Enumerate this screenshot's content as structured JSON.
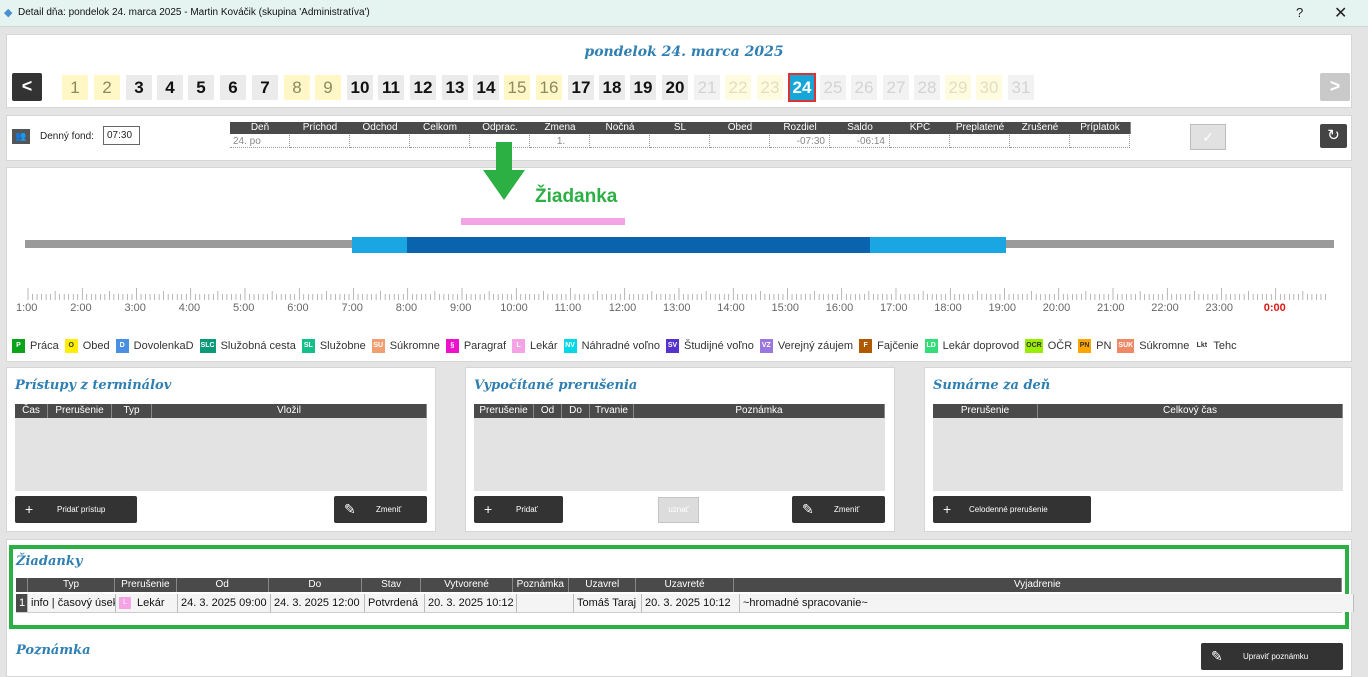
{
  "window": {
    "title": "Detail dňa: pondelok 24. marca 2025 -  Martin Kováčik  (skupina 'Administratíva')",
    "help": "?",
    "close": "✕"
  },
  "date_nav": {
    "title": "pondelok 24. marca 2025",
    "prev": "<",
    "next": ">",
    "days": [
      {
        "n": "1",
        "t": "we"
      },
      {
        "n": "2",
        "t": "we"
      },
      {
        "n": "3",
        "t": "wd"
      },
      {
        "n": "4",
        "t": "wd"
      },
      {
        "n": "5",
        "t": "wd"
      },
      {
        "n": "6",
        "t": "wd"
      },
      {
        "n": "7",
        "t": "wd"
      },
      {
        "n": "8",
        "t": "we"
      },
      {
        "n": "9",
        "t": "we"
      },
      {
        "n": "10",
        "t": "wd"
      },
      {
        "n": "11",
        "t": "wd"
      },
      {
        "n": "12",
        "t": "wd"
      },
      {
        "n": "13",
        "t": "wd"
      },
      {
        "n": "14",
        "t": "wd"
      },
      {
        "n": "15",
        "t": "we"
      },
      {
        "n": "16",
        "t": "we"
      },
      {
        "n": "17",
        "t": "wd"
      },
      {
        "n": "18",
        "t": "wd"
      },
      {
        "n": "19",
        "t": "wd"
      },
      {
        "n": "20",
        "t": "wd"
      },
      {
        "n": "21",
        "t": "fu"
      },
      {
        "n": "22",
        "t": "fuwe"
      },
      {
        "n": "23",
        "t": "fuwe"
      },
      {
        "n": "24",
        "t": "sel"
      },
      {
        "n": "25",
        "t": "fu"
      },
      {
        "n": "26",
        "t": "fu"
      },
      {
        "n": "27",
        "t": "fu"
      },
      {
        "n": "28",
        "t": "fu"
      },
      {
        "n": "29",
        "t": "fuwe"
      },
      {
        "n": "30",
        "t": "fuwe"
      },
      {
        "n": "31",
        "t": "fu"
      }
    ]
  },
  "summary": {
    "fond_label": "Denný fond:",
    "fond_value": "07:30",
    "headers": [
      "Deň",
      "Príchod",
      "Odchod",
      "Celkom",
      "Odprac.",
      "Zmena",
      "Nočná",
      "SL",
      "Obed",
      "Rozdiel",
      "Saldo",
      "KPČ",
      "Preplatené",
      "Zrušené",
      "Príplatok"
    ],
    "values": [
      "24. po",
      "",
      "",
      "",
      "",
      "1.",
      "",
      "",
      "",
      "-07:30",
      "-06:14",
      "",
      "",
      "",
      ""
    ]
  },
  "timeline": {
    "ziadanka_label": "Žiadanka",
    "hours": [
      "1:00",
      "2:00",
      "3:00",
      "4:00",
      "5:00",
      "6:00",
      "7:00",
      "8:00",
      "9:00",
      "10:00",
      "11:00",
      "12:00",
      "13:00",
      "14:00",
      "15:00",
      "16:00",
      "17:00",
      "18:00",
      "19:00",
      "20:00",
      "21:00",
      "22:00",
      "23:00",
      "0:00"
    ]
  },
  "legend": [
    {
      "code": "P",
      "label": "Práca",
      "bg": "#0aa31a",
      "fg": "#ffffff"
    },
    {
      "code": "O",
      "label": "Obed",
      "bg": "#ffee00",
      "fg": "#333333"
    },
    {
      "code": "D",
      "label": "DovolenkaD",
      "bg": "#4a90e2",
      "fg": "#ffffff"
    },
    {
      "code": "SLC",
      "label": "Služobná cesta",
      "bg": "#0a9a7a",
      "fg": "#ffffff"
    },
    {
      "code": "SL",
      "label": "Služobne",
      "bg": "#13c08a",
      "fg": "#ffffff"
    },
    {
      "code": "SU",
      "label": "Súkromne",
      "bg": "#f0a070",
      "fg": "#ffffff"
    },
    {
      "code": "§",
      "label": "Paragraf",
      "bg": "#ee11cc",
      "fg": "#ffffff"
    },
    {
      "code": "L",
      "label": "Lekár",
      "bg": "#f4a3e6",
      "fg": "#ffffff"
    },
    {
      "code": "NV",
      "label": "Náhradné voľno",
      "bg": "#00d8e8",
      "fg": "#ffffff"
    },
    {
      "code": "SV",
      "label": "Študijné voľno",
      "bg": "#5533cc",
      "fg": "#ffffff"
    },
    {
      "code": "VZ",
      "label": "Verejný záujem",
      "bg": "#9a77dd",
      "fg": "#ffffff"
    },
    {
      "code": "F",
      "label": "Fajčenie",
      "bg": "#b05a00",
      "fg": "#ffffff"
    },
    {
      "code": "LD",
      "label": "Lekár doprovod",
      "bg": "#33dd77",
      "fg": "#ffffff"
    },
    {
      "code": "OCR",
      "label": "OČR",
      "bg": "#99ee00",
      "fg": "#333333"
    },
    {
      "code": "PN",
      "label": "PN",
      "bg": "#ffa500",
      "fg": "#333333"
    },
    {
      "code": "SUK",
      "label": "Súkromne",
      "bg": "#ee8866",
      "fg": "#ffffff"
    },
    {
      "code": "Lkt",
      "label": "Tehc",
      "bg": "#ffffff",
      "fg": "#333333"
    }
  ],
  "pristupy": {
    "title": "Prístupy z terminálov",
    "headers": [
      "Čas",
      "Prerušenie",
      "Typ",
      "Vložil"
    ],
    "add_btn": "Pridať prístup",
    "edit_btn": "Zmeniť"
  },
  "vypocitane": {
    "title": "Vypočítané prerušenia",
    "headers": [
      "Prerušenie",
      "Od",
      "Do",
      "Trvanie",
      "Poznámka"
    ],
    "add_btn": "Pridať",
    "uznat_btn": "uznať",
    "edit_btn": "Zmeniť"
  },
  "sumarne": {
    "title": "Sumárne za deň",
    "headers": [
      "Prerušenie",
      "Celkový čas"
    ],
    "add_btn": "Celodenné prerušenie"
  },
  "ziadanky": {
    "title": "Žiadanky",
    "headers": [
      "Typ",
      "Prerušenie",
      "Od",
      "Do",
      "Stav",
      "Vytvorené",
      "Poznámka",
      "Uzavrel",
      "Uzavreté",
      "Vyjadrenie"
    ],
    "rows": [
      {
        "num": "1",
        "typ": "info | časový úsek",
        "prer_code": "L",
        "prer": "Lekár",
        "od": "24. 3. 2025 09:00",
        "do": "24. 3. 2025 12:00",
        "stav": "Potvrdená",
        "vytvorene": "20. 3. 2025  10:12",
        "poznamka": "",
        "uzavrel": "Tomáš Taraj",
        "uzavrete": "20. 3. 2025  10:12",
        "vyjadrenie": "~hromadné spracovanie~"
      }
    ]
  },
  "poznamka": {
    "title": "Poznámka",
    "edit_btn": "Upraviť poznámku"
  }
}
